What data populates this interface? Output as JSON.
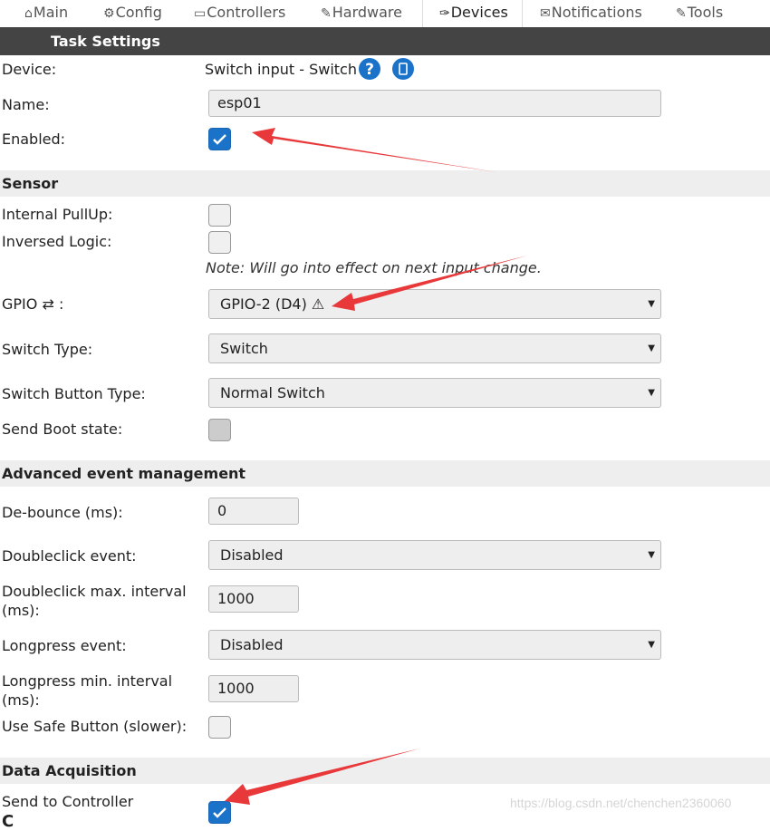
{
  "tabs": [
    {
      "label": "Main",
      "icon": "home-icon"
    },
    {
      "label": "Config",
      "icon": "gear-icon"
    },
    {
      "label": "Controllers",
      "icon": "controllers-icon"
    },
    {
      "label": "Hardware",
      "icon": "pin-icon"
    },
    {
      "label": "Devices",
      "icon": "plug-icon",
      "active": true
    },
    {
      "label": "Notifications",
      "icon": "mail-icon"
    },
    {
      "label": "Tools",
      "icon": "wrench-icon"
    }
  ],
  "title": "Task Settings",
  "device": {
    "label": "Device:",
    "value": "Switch input - Switch"
  },
  "name": {
    "label": "Name:",
    "value": "esp01"
  },
  "enabled": {
    "label": "Enabled:",
    "checked": true
  },
  "sensor": {
    "header": "Sensor",
    "pullup_label": "Internal PullUp:",
    "inversed_label": "Inversed Logic:",
    "note": "Note: Will go into effect on next input change.",
    "gpio_label": "GPIO ⇄ :",
    "gpio_value": "GPIO-2 (D4) ⚠",
    "switch_type_label": "Switch Type:",
    "switch_type_value": "Switch",
    "switch_button_label": "Switch Button Type:",
    "switch_button_value": "Normal Switch",
    "boot_label": "Send Boot state:"
  },
  "advanced": {
    "header": "Advanced event management",
    "debounce_label": "De-bounce (ms):",
    "debounce_value": "0",
    "dblclick_label": "Doubleclick event:",
    "dblclick_value": "Disabled",
    "dblclick_interval_label_1": "Doubleclick max. interval",
    "dblclick_interval_label_2": "(ms):",
    "dblclick_interval_value": "1000",
    "longpress_label": "Longpress event:",
    "longpress_value": "Disabled",
    "longpress_interval_label_1": "Longpress min. interval",
    "longpress_interval_label_2": "(ms):",
    "longpress_interval_value": "1000",
    "safe_label": "Use Safe Button (slower):"
  },
  "data_acquisition": {
    "header": "Data Acquisition",
    "send_label": "Send to Controller",
    "send_checked": true
  },
  "watermark": "https://blog.csdn.net/chenchen2360060",
  "colors": {
    "accent": "#1a73c8",
    "header": "#444444",
    "section": "#eeeeee",
    "arrow": "#e8383a"
  }
}
